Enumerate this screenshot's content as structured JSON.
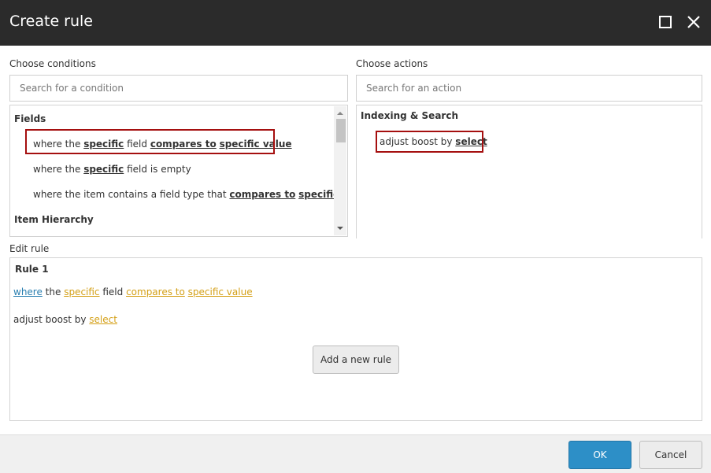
{
  "dialog": {
    "title": "Create rule"
  },
  "conditions": {
    "label": "Choose conditions",
    "search_placeholder": "Search for a condition",
    "groups": [
      {
        "heading": "Fields",
        "items": [
          {
            "parts": [
              "where the ",
              "specific",
              " field ",
              "compares to",
              " ",
              "specific value"
            ]
          },
          {
            "parts": [
              "where the ",
              "specific",
              " field is empty"
            ]
          },
          {
            "parts": [
              "where the item contains a field type that ",
              "compares to",
              " ",
              "specific"
            ]
          }
        ]
      },
      {
        "heading": "Item Hierarchy"
      }
    ]
  },
  "actions": {
    "label": "Choose actions",
    "search_placeholder": "Search for an action",
    "groups": [
      {
        "heading": "Indexing & Search",
        "items": [
          {
            "parts": [
              "adjust boost by ",
              "select"
            ]
          }
        ]
      }
    ]
  },
  "edit": {
    "label": "Edit rule",
    "rule_title": "Rule 1",
    "condition_parts": [
      "where",
      " the ",
      "specific",
      " field ",
      "compares to",
      " ",
      "specific value"
    ],
    "action_parts": [
      "adjust boost by ",
      "select"
    ],
    "add_rule_label": "Add a new rule"
  },
  "footer": {
    "ok_label": "OK",
    "cancel_label": "Cancel"
  },
  "colors": {
    "titlebar": "#2b2b2b",
    "highlight": "#a50f0f",
    "link_blue": "#2a7fb0",
    "link_gold": "#d4a017",
    "primary_button": "#2d8fc7"
  }
}
